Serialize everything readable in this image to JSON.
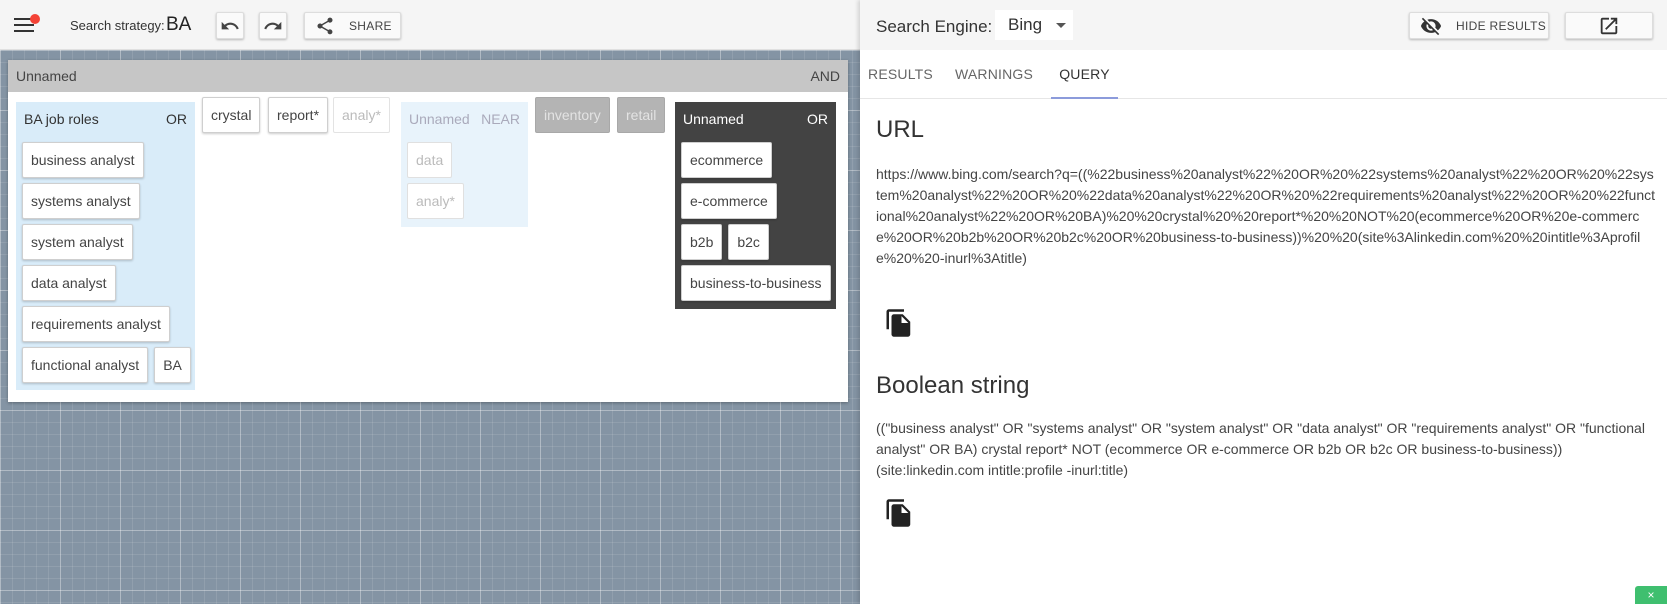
{
  "topbar": {
    "strategy_label": "Search strategy:",
    "strategy_name": "BA",
    "share_label": "SHARE"
  },
  "canvas": {
    "and_group": {
      "name": "Unnamed",
      "operator": "AND"
    },
    "ba_group": {
      "name": "BA job roles",
      "operator": "OR",
      "terms": [
        "business analyst",
        "systems analyst",
        "system analyst",
        "data analyst",
        "requirements analyst",
        "functional analyst",
        "BA"
      ]
    },
    "loose_terms": [
      "crystal",
      "report*",
      "analy*"
    ],
    "near_group": {
      "name": "Unnamed",
      "operator": "NEAR",
      "terms": [
        "data",
        "analy*"
      ]
    },
    "disabled_terms": [
      "inventory",
      "retail"
    ],
    "or_group": {
      "name": "Unnamed",
      "operator": "OR",
      "terms": [
        "ecommerce",
        "e-commerce",
        "b2b",
        "b2c",
        "business-to-business"
      ]
    }
  },
  "results_panel": {
    "engine_label": "Search Engine:",
    "engine_value": "Bing",
    "hide_label": "HIDE RESULTS",
    "tabs": [
      "RESULTS",
      "WARNINGS",
      "QUERY"
    ],
    "active_tab": "QUERY",
    "url_title": "URL",
    "url_value": "https://www.bing.com/search?q=((%22business%20analyst%22%20OR%20%22systems%20analyst%22%20OR%20%22system%20analyst%22%20OR%20%22data%20analyst%22%20OR%20%22requirements%20analyst%22%20OR%20%22functional%20analyst%22%20OR%20BA)%20%20crystal%20%20report*%20%20NOT%20(ecommerce%20OR%20e-commerce%20OR%20b2b%20OR%20b2c%20OR%20business-to-business))%20%20(site%3Alinkedin.com%20%20intitle%3Aprofile%20%20-inurl%3Atitle)",
    "boolean_title": "Boolean string",
    "boolean_value": "((\"business analyst\" OR \"systems analyst\" OR \"system analyst\" OR \"data analyst\" OR \"requirements analyst\" OR \"functional analyst\" OR BA) crystal report* NOT (ecommerce OR e-commerce OR b2b OR b2c OR business-to-business)) (site:linkedin.com intitle:profile -inurl:title)"
  },
  "icons": {
    "menu": "hamburger-icon",
    "undo": "undo-icon",
    "redo": "redo-icon",
    "share": "share-icon",
    "hide": "visibility-off-icon",
    "open_external": "open-in-new-icon",
    "copy": "copy-icon"
  },
  "colors": {
    "accent_tab": "#8c9bdb",
    "canvas_bg": "#8494a4",
    "ba_group_bg": "#d9ecf9",
    "or_group_bg": "#434343",
    "notification_dot": "#f44336"
  }
}
